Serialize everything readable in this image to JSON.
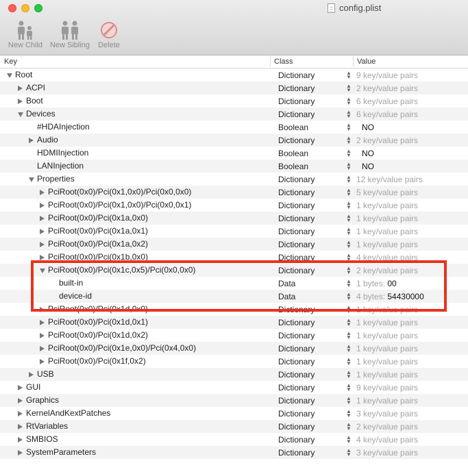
{
  "window": {
    "title": "config.plist"
  },
  "toolbar": {
    "new_child": "New Child",
    "new_sibling": "New Sibling",
    "delete": "Delete"
  },
  "columns": {
    "key": "Key",
    "class": "Class",
    "value": "Value"
  },
  "rows": [
    {
      "key": "Root",
      "cls": "Dictionary",
      "value": "9 key/value pairs",
      "depth": 0,
      "disclosure": "expanded"
    },
    {
      "key": "ACPI",
      "cls": "Dictionary",
      "value": "2 key/value pairs",
      "depth": 1,
      "disclosure": "collapsed"
    },
    {
      "key": "Boot",
      "cls": "Dictionary",
      "value": "6 key/value pairs",
      "depth": 1,
      "disclosure": "collapsed"
    },
    {
      "key": "Devices",
      "cls": "Dictionary",
      "value": "6 key/value pairs",
      "depth": 1,
      "disclosure": "expanded"
    },
    {
      "key": "#HDAInjection",
      "cls": "Boolean",
      "value": "NO",
      "depth": 2,
      "disclosure": "none"
    },
    {
      "key": "Audio",
      "cls": "Dictionary",
      "value": "2 key/value pairs",
      "depth": 2,
      "disclosure": "collapsed"
    },
    {
      "key": "HDMIInjection",
      "cls": "Boolean",
      "value": "NO",
      "depth": 2,
      "disclosure": "none"
    },
    {
      "key": "LANInjection",
      "cls": "Boolean",
      "value": "NO",
      "depth": 2,
      "disclosure": "none"
    },
    {
      "key": "Properties",
      "cls": "Dictionary",
      "value": "12 key/value pairs",
      "depth": 2,
      "disclosure": "expanded"
    },
    {
      "key": "PciRoot(0x0)/Pci(0x1,0x0)/Pci(0x0,0x0)",
      "cls": "Dictionary",
      "value": "5 key/value pairs",
      "depth": 3,
      "disclosure": "collapsed"
    },
    {
      "key": "PciRoot(0x0)/Pci(0x1,0x0)/Pci(0x0,0x1)",
      "cls": "Dictionary",
      "value": "1 key/value pairs",
      "depth": 3,
      "disclosure": "collapsed"
    },
    {
      "key": "PciRoot(0x0)/Pci(0x1a,0x0)",
      "cls": "Dictionary",
      "value": "1 key/value pairs",
      "depth": 3,
      "disclosure": "collapsed"
    },
    {
      "key": "PciRoot(0x0)/Pci(0x1a,0x1)",
      "cls": "Dictionary",
      "value": "1 key/value pairs",
      "depth": 3,
      "disclosure": "collapsed"
    },
    {
      "key": "PciRoot(0x0)/Pci(0x1a,0x2)",
      "cls": "Dictionary",
      "value": "1 key/value pairs",
      "depth": 3,
      "disclosure": "collapsed"
    },
    {
      "key": "PciRoot(0x0)/Pci(0x1b,0x0)",
      "cls": "Dictionary",
      "value": "4 key/value pairs",
      "depth": 3,
      "disclosure": "collapsed"
    },
    {
      "key": "PciRoot(0x0)/Pci(0x1c,0x5)/Pci(0x0,0x0)",
      "cls": "Dictionary",
      "value": "2 key/value pairs",
      "depth": 3,
      "disclosure": "expanded"
    },
    {
      "key": "built-in",
      "cls": "Data",
      "value": "1 bytes:",
      "value_num": "00",
      "depth": 4,
      "disclosure": "none"
    },
    {
      "key": "device-id",
      "cls": "Data",
      "value": "4 bytes:",
      "value_num": "54430000",
      "depth": 4,
      "disclosure": "none"
    },
    {
      "key": "PciRoot(0x0)/Pci(0x1d,0x0)",
      "cls": "Dictionary",
      "value": "1 key/value pairs",
      "depth": 3,
      "disclosure": "collapsed"
    },
    {
      "key": "PciRoot(0x0)/Pci(0x1d,0x1)",
      "cls": "Dictionary",
      "value": "1 key/value pairs",
      "depth": 3,
      "disclosure": "collapsed"
    },
    {
      "key": "PciRoot(0x0)/Pci(0x1d,0x2)",
      "cls": "Dictionary",
      "value": "1 key/value pairs",
      "depth": 3,
      "disclosure": "collapsed"
    },
    {
      "key": "PciRoot(0x0)/Pci(0x1e,0x0)/Pci(0x4,0x0)",
      "cls": "Dictionary",
      "value": "1 key/value pairs",
      "depth": 3,
      "disclosure": "collapsed"
    },
    {
      "key": "PciRoot(0x0)/Pci(0x1f,0x2)",
      "cls": "Dictionary",
      "value": "1 key/value pairs",
      "depth": 3,
      "disclosure": "collapsed"
    },
    {
      "key": "USB",
      "cls": "Dictionary",
      "value": "1 key/value pairs",
      "depth": 2,
      "disclosure": "collapsed"
    },
    {
      "key": "GUI",
      "cls": "Dictionary",
      "value": "9 key/value pairs",
      "depth": 1,
      "disclosure": "collapsed"
    },
    {
      "key": "Graphics",
      "cls": "Dictionary",
      "value": "1 key/value pairs",
      "depth": 1,
      "disclosure": "collapsed"
    },
    {
      "key": "KernelAndKextPatches",
      "cls": "Dictionary",
      "value": "3 key/value pairs",
      "depth": 1,
      "disclosure": "collapsed"
    },
    {
      "key": "RtVariables",
      "cls": "Dictionary",
      "value": "2 key/value pairs",
      "depth": 1,
      "disclosure": "collapsed"
    },
    {
      "key": "SMBIOS",
      "cls": "Dictionary",
      "value": "4 key/value pairs",
      "depth": 1,
      "disclosure": "collapsed"
    },
    {
      "key": "SystemParameters",
      "cls": "Dictionary",
      "value": "3 key/value pairs",
      "depth": 1,
      "disclosure": "collapsed"
    }
  ],
  "colors": {
    "highlight": "#e8331e",
    "muted_value": "#a4a4a4"
  }
}
